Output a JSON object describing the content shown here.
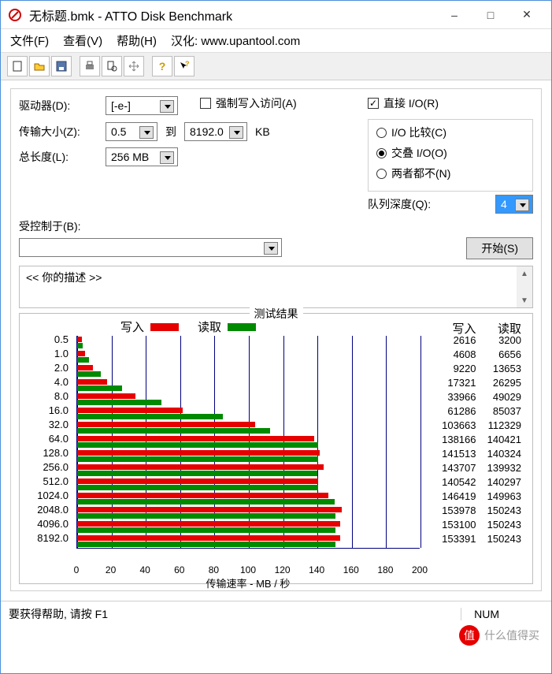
{
  "window": {
    "title": "无标题.bmk - ATTO Disk Benchmark"
  },
  "menu": {
    "file": "文件(F)",
    "view": "查看(V)",
    "help": "帮助(H)",
    "hanhua": "汉化: www.upantool.com"
  },
  "toolbar_icons": {
    "new": "new-icon",
    "open": "open-icon",
    "save": "save-icon",
    "print": "print-icon",
    "preview": "preview-icon",
    "move": "move-icon",
    "help": "help-icon",
    "whats": "whats-this-icon"
  },
  "labels": {
    "drive": "驱动器(D):",
    "transfer_size": "传输大小(Z):",
    "total_length": "总长度(L):",
    "to": "到",
    "kb": "KB",
    "force_write": "强制写入访问(A)",
    "direct_io": "直接 I/O(R)",
    "io_compare": "I/O 比较(C)",
    "overlap_io": "交叠 I/O(O)",
    "neither": "两者都不(N)",
    "queue_depth": "队列深度(Q):",
    "controlled_by": "受控制于(B):",
    "start_btn": "开始(S)",
    "your_desc": "<<  你的描述   >>",
    "results_title": "测试结果",
    "write": "写入",
    "read": "读取",
    "xlabel": "传输速率 - MB / 秒"
  },
  "values": {
    "drive": "[-e-]",
    "size_from": "0.5",
    "size_to": "8192.0",
    "total_length": "256 MB",
    "queue_depth": "4",
    "direct_io_checked": true,
    "io_mode_selected": "overlap"
  },
  "chart_data": {
    "type": "bar",
    "categories": [
      "0.5",
      "1.0",
      "2.0",
      "4.0",
      "8.0",
      "16.0",
      "32.0",
      "64.0",
      "128.0",
      "256.0",
      "512.0",
      "1024.0",
      "2048.0",
      "4096.0",
      "8192.0"
    ],
    "series": [
      {
        "name": "写入",
        "values": [
          2616,
          4608,
          9220,
          17321,
          33966,
          61286,
          103663,
          138166,
          141513,
          143707,
          140542,
          146419,
          153978,
          153100,
          153391
        ]
      },
      {
        "name": "读取",
        "values": [
          3200,
          6656,
          13653,
          26295,
          49029,
          85037,
          112329,
          140421,
          140324,
          139932,
          140297,
          149963,
          150243,
          150243,
          150243
        ]
      }
    ],
    "xlabel": "传输速率 - MB / 秒",
    "ylabel": "",
    "xlim": [
      0,
      200
    ],
    "x_ticks": [
      0,
      20,
      40,
      60,
      80,
      100,
      120,
      140,
      160,
      180,
      200
    ],
    "legend": [
      "写入",
      "读取"
    ],
    "title": "测试结果"
  },
  "status": {
    "help_hint": "要获得帮助, 请按 F1",
    "num": "NUM"
  },
  "watermark": {
    "brand": "什么值得买",
    "icon": "值"
  }
}
